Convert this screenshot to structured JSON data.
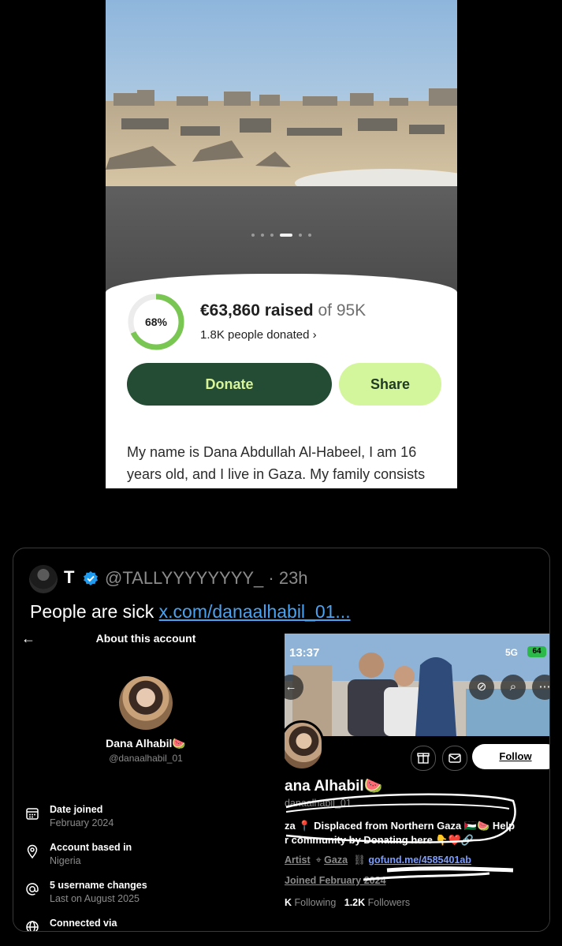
{
  "fundraiser": {
    "carousel_pages": 6,
    "carousel_active": 3,
    "progress_percent": 68,
    "progress_label": "68%",
    "raised_amount": "€63,860 raised",
    "raised_goal": "of 95K",
    "donors": "1.8K people donated",
    "donate_label": "Donate",
    "share_label": "Share",
    "story": "My name is Dana Abdullah Al-Habeel, I am 16 years old, and I live in Gaza. My family consists",
    "colors": {
      "donate_bg": "#244b33",
      "share_bg": "#d3f59c",
      "progress": "#79c653"
    }
  },
  "tweet": {
    "author_initial": "T",
    "handle_time": "@TALLYYYYYYYY_ · 23h",
    "text": "People are sick ",
    "link": "x.com/danaalhabil_01...",
    "colors": {
      "link": "#4aa3f0",
      "badge": "#1d9bf0"
    }
  },
  "about": {
    "back": "←",
    "title": "About this account",
    "name": "Dana Alhabil🍉",
    "handle": "@danaalhabil_01",
    "rows": [
      {
        "icon": "calendar-icon",
        "label": "Date joined",
        "value": "February 2024"
      },
      {
        "icon": "location-icon",
        "label": "Account based in",
        "value": "Nigeria"
      },
      {
        "icon": "at-icon",
        "label": "5 username changes",
        "value": "Last on August 2025"
      },
      {
        "icon": "globe-icon",
        "label": "Connected via",
        "value": ""
      }
    ]
  },
  "profile": {
    "status_time": "13:37",
    "network": "5G",
    "battery": "64",
    "follow_label": "Follow",
    "name": "ana Alhabil🍉",
    "handle": "danaalhabil_01",
    "bio_line1": "za 📍 Displaced from Northern Gaza 🇵🇸🍉 Help",
    "bio_line2": "r community by Donating here 👇❤️🔗",
    "meta_artist": "Artist",
    "meta_location": "Gaza",
    "meta_link": "gofund.me/4585401ab",
    "joined": "Joined February 2024",
    "following_count": "K",
    "following_label": "Following",
    "followers_count": "1.2K",
    "followers_label": "Followers"
  }
}
